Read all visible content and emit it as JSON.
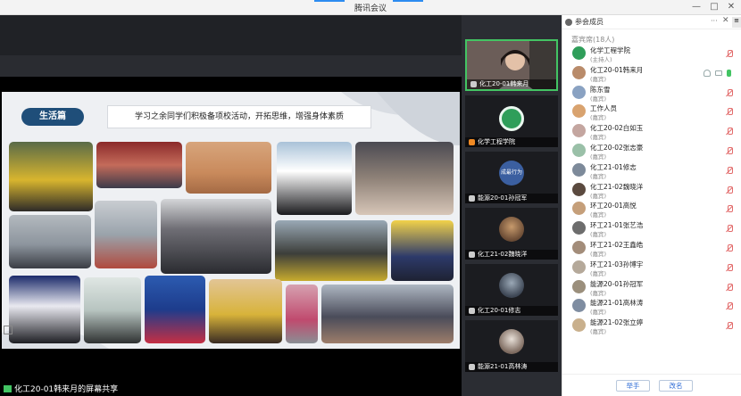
{
  "window": {
    "title": "腾讯会议",
    "controls": {
      "minimize": "—",
      "maximize": "□",
      "close": "✕"
    }
  },
  "slide": {
    "tag": "生活篇",
    "caption": "学习之余同学们积极备项校活动，开拓思维，增强身体素质"
  },
  "share_label": "化工20-01韩来月的屏幕共享",
  "video_tiles": [
    {
      "name": "化工20-01韩来月",
      "type": "camera"
    },
    {
      "name": "化学工程学院",
      "type": "logo"
    },
    {
      "name": "能源20-01孙冠军",
      "type": "avatar",
      "avatar_text": "成最行为"
    },
    {
      "name": "化工21-02魏晓洋",
      "type": "avatar"
    },
    {
      "name": "化工20-01修志",
      "type": "avatar"
    },
    {
      "name": "能源21-01高林涛",
      "type": "avatar"
    }
  ],
  "panel": {
    "title": "参会成员",
    "more_icon": "···",
    "section_label": "嘉宾席(18人)",
    "participants": [
      {
        "name": "化学工程学院",
        "role": "(主持人)",
        "color": "#2f9e5a",
        "mic": "off"
      },
      {
        "name": "化工20-01韩来月",
        "role": "(嘉宾)",
        "color": "#b98b6a",
        "mic": "on"
      },
      {
        "name": "陈东雪",
        "role": "(嘉宾)",
        "color": "#8aa2c2",
        "mic": "off"
      },
      {
        "name": "工作人员",
        "role": "(嘉宾)",
        "color": "#d9a36f",
        "mic": "off"
      },
      {
        "name": "化工20-02白如玉",
        "role": "(嘉宾)",
        "color": "#c4a6a0",
        "mic": "off"
      },
      {
        "name": "化工20-02张志豪",
        "role": "(嘉宾)",
        "color": "#9ac0a8",
        "mic": "off"
      },
      {
        "name": "化工21-01修志",
        "role": "(嘉宾)",
        "color": "#7d8a9a",
        "mic": "off"
      },
      {
        "name": "化工21-02魏晓洋",
        "role": "(嘉宾)",
        "color": "#5b4a3f",
        "mic": "off"
      },
      {
        "name": "环工20-01高悦",
        "role": "(嘉宾)",
        "color": "#c59f7a",
        "mic": "off"
      },
      {
        "name": "环工21-01张艺浩",
        "role": "(嘉宾)",
        "color": "#6d6d6d",
        "mic": "off"
      },
      {
        "name": "环工21-02王鑫皓",
        "role": "(嘉宾)",
        "color": "#a38d7a",
        "mic": "off"
      },
      {
        "name": "环工21-03孙博宇",
        "role": "(嘉宾)",
        "color": "#b5a99a",
        "mic": "off"
      },
      {
        "name": "能源20-01孙冠军",
        "role": "(嘉宾)",
        "color": "#9b8f7c",
        "mic": "off"
      },
      {
        "name": "能源21-01高林涛",
        "role": "(嘉宾)",
        "color": "#7f8da1",
        "mic": "off"
      },
      {
        "name": "能源21-02张立婷",
        "role": "(嘉宾)",
        "color": "#c9b08d",
        "mic": "off"
      }
    ],
    "raise_hand": "举手",
    "rename": "改名"
  }
}
